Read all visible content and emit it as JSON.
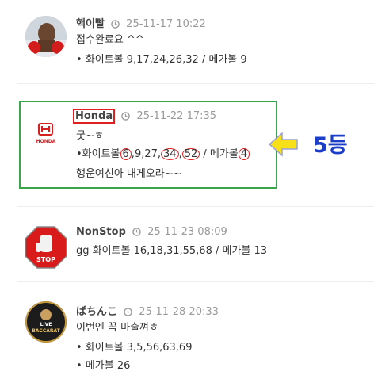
{
  "comments": [
    {
      "nick": "핵이빨",
      "time": "25-11-17 10:22",
      "lines": [
        "접수완료요 ^^",
        "• 화이트볼 9,17,24,26,32 / 메가볼 9"
      ],
      "avatar": "boxer-photo"
    },
    {
      "nick": "Honda",
      "time": "25-11-22 17:35",
      "line1": "굿~ㅎ",
      "line2": {
        "prefix": "•화이트볼",
        "n1": "6",
        "mid1": "9,27",
        "n2": "34",
        "n3": "52",
        "suffix": "/ 메가볼",
        "n4": "4"
      },
      "line3": "행운여신아 내게오라~~",
      "avatar": "honda-logo",
      "logo_text": "HONDA"
    },
    {
      "nick": "NonStop",
      "time": "25-11-23 08:09",
      "lines": [
        "gg 화이트볼 16,18,31,55,68 / 메가볼 13"
      ],
      "avatar": "stop-sign",
      "sign_text": "STOP"
    },
    {
      "nick": "ぱちんこ",
      "time": "25-11-28 20:33",
      "lines": [
        "이번엔 꼭 마출껴ㅎ",
        "• 화이트볼 3,5,56,63,69",
        "• 메가볼 26"
      ],
      "avatar": "live-baccarat-badge",
      "badge_top": "LIVE",
      "badge_bottom": "BACCARAT"
    }
  ],
  "annotation": {
    "rank_label": "5등"
  },
  "colors": {
    "highlight_box": "#3aa54a",
    "circle_mark": "#e02020",
    "arrow": "#f7e01a",
    "rank_text": "#1a3ec8"
  }
}
